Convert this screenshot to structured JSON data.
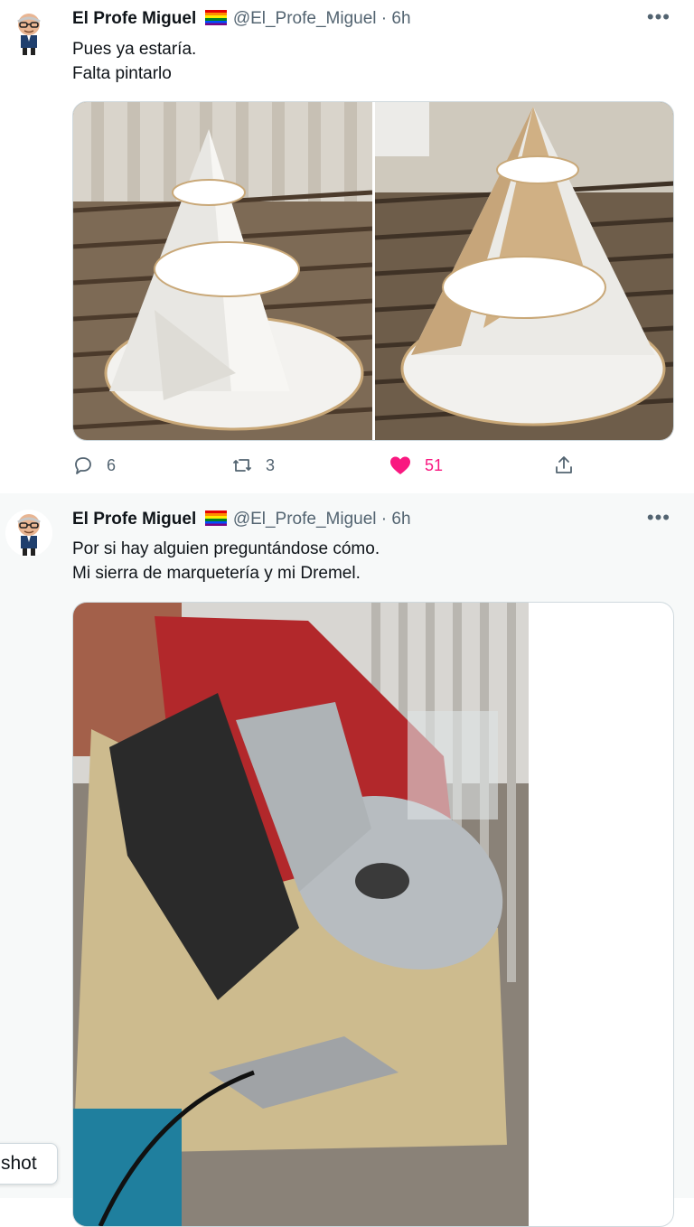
{
  "tweets": [
    {
      "author": {
        "name": "El Profe Miguel",
        "handle": "@El_Profe_Miguel",
        "time": "6h",
        "flag_icon": "rainbow-flag-emoji"
      },
      "text": [
        "Pues ya estaría.",
        "Falta pintarlo"
      ],
      "images": [
        "spiral-cone-white-view",
        "spiral-cone-cardboard-view"
      ],
      "actions": {
        "reply": {
          "icon": "reply-icon",
          "count": "6"
        },
        "retweet": {
          "icon": "retweet-icon",
          "count": "3"
        },
        "like": {
          "icon": "heart-icon",
          "count": "51",
          "liked": true,
          "color": "#f91880"
        },
        "share": {
          "icon": "share-icon"
        }
      },
      "more_icon": "more-icon"
    },
    {
      "author": {
        "name": "El Profe Miguel",
        "handle": "@El_Profe_Miguel",
        "time": "6h",
        "flag_icon": "rainbow-flag-emoji"
      },
      "text": [
        "Por si hay alguien preguntándose cómo.",
        "Mi sierra de marquetería y mi Dremel."
      ],
      "images": [
        "scroll-saw-and-dremel"
      ],
      "more_icon": "more-icon"
    }
  ],
  "overlay": {
    "label": "shot"
  },
  "colors": {
    "secondary_text": "#536471",
    "like_pink": "#f91880",
    "border": "#cfd9de"
  }
}
